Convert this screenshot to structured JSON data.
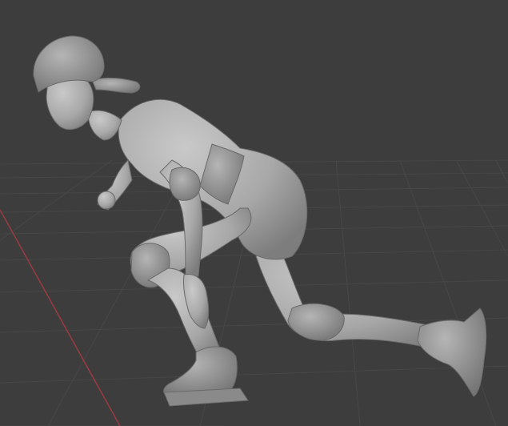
{
  "viewport": {
    "mode": "3d-viewport",
    "shading": "solid",
    "background_color": "#3d3d3d",
    "grid_color": "#4a4a4a",
    "x_axis_color": "#b33a45",
    "object_color": "#a9a9a9"
  },
  "scene": {
    "object": "inline-skater-sculpt",
    "show_floor_grid": true,
    "show_x_axis": true
  }
}
